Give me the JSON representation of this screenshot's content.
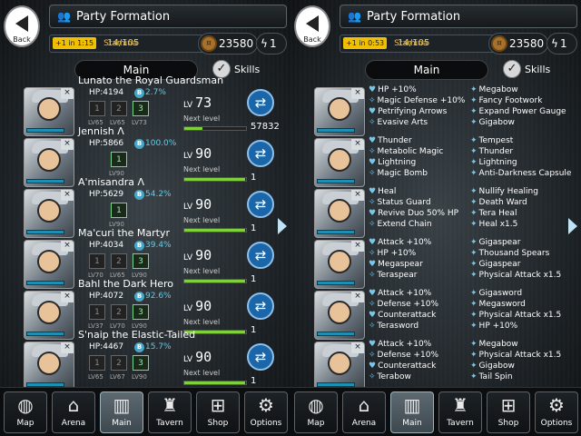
{
  "header": {
    "title": "Party Formation",
    "back": "Back",
    "timer": "+1 in 1:15",
    "stamina_label": "Stamina",
    "stamina": "14/105",
    "coins": "23580",
    "bolts": "1",
    "main": "Main",
    "skills": "Skills",
    "check": "✓"
  },
  "header_r": {
    "timer": "+1 in 0:53"
  },
  "units": [
    {
      "name": "Lunato the Royal Guardsman",
      "hp": "HP:4194",
      "bp": "2.7%",
      "sk": [
        "1",
        "2",
        "3"
      ],
      "skl": [
        "LV65",
        "LV65",
        "LV73"
      ],
      "lvl": "LV",
      "lv": "73",
      "next": "Next level",
      "xp": "57832",
      "xpf": 0.3
    },
    {
      "name": "Jennish Λ",
      "hp": "HP:5866",
      "bp": "100.0%",
      "sk": [
        "1"
      ],
      "skl": [
        "LV90"
      ],
      "lvl": "LV",
      "lv": "90",
      "next": "Next level",
      "xp": "1",
      "xpf": 0.99
    },
    {
      "name": "A'misandra Λ",
      "hp": "HP:5629",
      "bp": "54.2%",
      "sk": [
        "1"
      ],
      "skl": [
        "LV90"
      ],
      "lvl": "LV",
      "lv": "90",
      "next": "Next level",
      "xp": "1",
      "xpf": 0.99
    },
    {
      "name": "Ma'curi the Martyr",
      "hp": "HP:4034",
      "bp": "39.4%",
      "sk": [
        "1",
        "2",
        "3"
      ],
      "skl": [
        "LV70",
        "LV65",
        "LV90"
      ],
      "lvl": "LV",
      "lv": "90",
      "next": "Next level",
      "xp": "1",
      "xpf": 0.99
    },
    {
      "name": "Bahl the Dark Hero",
      "hp": "HP:4072",
      "bp": "92.6%",
      "sk": [
        "1",
        "2",
        "3"
      ],
      "skl": [
        "LV37",
        "LV70",
        "LV90"
      ],
      "lvl": "LV",
      "lv": "90",
      "next": "Next level",
      "xp": "1",
      "xpf": 0.99
    },
    {
      "name": "S'naip the Elastic-Tailed",
      "hp": "HP:4467",
      "bp": "15.7%",
      "sk": [
        "1",
        "2",
        "3"
      ],
      "skl": [
        "LV65",
        "LV67",
        "LV90"
      ],
      "lvl": "LV",
      "lv": "90",
      "next": "Next level",
      "xp": "1",
      "xpf": 0.99
    }
  ],
  "skills": [
    {
      "a": [
        "HP +10%",
        "Magic Defense +10%",
        "Petrifying Arrows",
        "Evasive Arts"
      ],
      "b": [
        "Megabow",
        "Fancy Footwork",
        "Expand Power Gauge",
        "Gigabow"
      ]
    },
    {
      "a": [
        "Thunder",
        "Metabolic Magic",
        "Lightning",
        "Magic Bomb"
      ],
      "b": [
        "Tempest",
        "Thunder",
        "Lightning",
        "Anti-Darkness Capsule"
      ]
    },
    {
      "a": [
        "Heal",
        "Status Guard",
        "Revive Duo 50% HP",
        "Extend Chain"
      ],
      "b": [
        "Nullify Healing",
        "Death Ward",
        "Tera Heal",
        "Heal x1.5"
      ]
    },
    {
      "a": [
        "Attack +10%",
        "HP +10%",
        "Megaspear",
        "Teraspear"
      ],
      "b": [
        "Gigaspear",
        "Thousand Spears",
        "Gigaspear",
        "Physical Attack x1.5"
      ]
    },
    {
      "a": [
        "Attack +10%",
        "Defense +10%",
        "Counterattack",
        "Terasword"
      ],
      "b": [
        "Gigasword",
        "Megasword",
        "Physical Attack x1.5",
        "HP +10%"
      ]
    },
    {
      "a": [
        "Attack +10%",
        "Defense +10%",
        "Counterattack",
        "Terabow"
      ],
      "b": [
        "Megabow",
        "Physical Attack x1.5",
        "Gigabow",
        "Tail Spin"
      ]
    }
  ],
  "nav": [
    {
      "label": "Map",
      "icon": "◍"
    },
    {
      "label": "Arena",
      "icon": "⌂"
    },
    {
      "label": "Main",
      "icon": "▥"
    },
    {
      "label": "Tavern",
      "icon": "♜"
    },
    {
      "label": "Shop",
      "icon": "⊞"
    },
    {
      "label": "Options",
      "icon": "⚙"
    }
  ]
}
